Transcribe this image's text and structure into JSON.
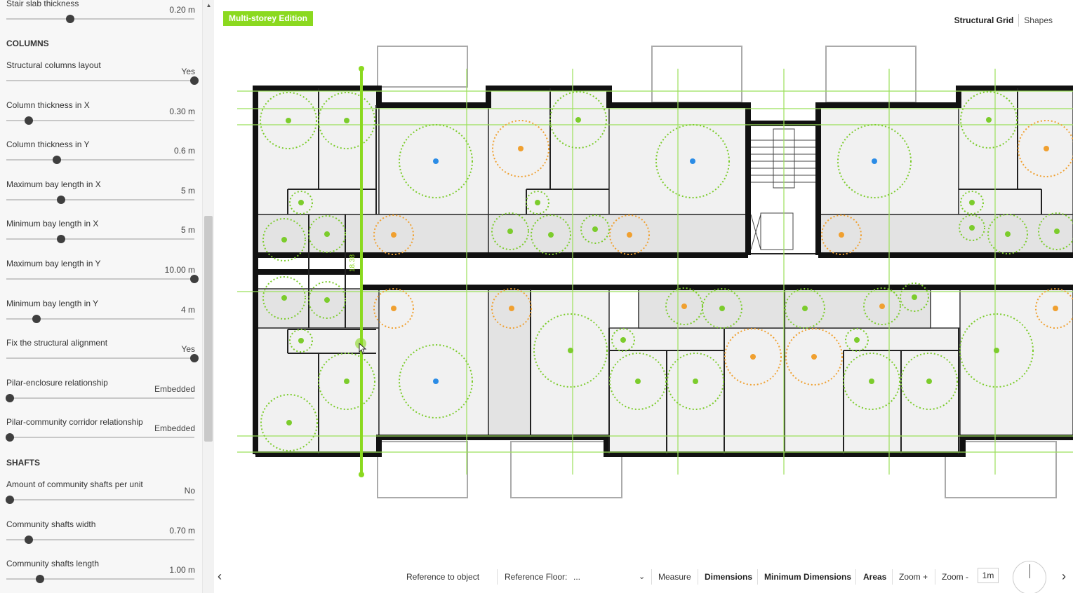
{
  "sidebar": {
    "partial_top": {
      "label": "Stair slab thickness",
      "value": "0.20 m",
      "level": 0.34
    },
    "columns_section": "COLUMNS",
    "columns": [
      {
        "label": "Structural columns layout",
        "value": "Yes",
        "level": 1.0
      },
      {
        "label": "Column thickness in X",
        "value": "0.30 m",
        "level": 0.12
      },
      {
        "label": "Column thickness in Y",
        "value": "0.6 m",
        "level": 0.27
      },
      {
        "label": "Maximum bay length in X",
        "value": "5 m",
        "level": 0.29
      },
      {
        "label": "Minimum bay length in X",
        "value": "5 m",
        "level": 0.29
      },
      {
        "label": "Maximum bay length in Y",
        "value": "10.00 m",
        "level": 1.0
      },
      {
        "label": "Minimum bay length in Y",
        "value": "4 m",
        "level": 0.16
      },
      {
        "label": "Fix the structural alignment",
        "value": "Yes",
        "level": 1.0
      },
      {
        "label": "Pilar-enclosure relationship",
        "value": "Embedded",
        "level": 0.02
      },
      {
        "label": "Pilar-community corridor relationship",
        "value": "Embedded",
        "level": 0.02
      }
    ],
    "shafts_section": "SHAFTS",
    "shafts": [
      {
        "label": "Amount of community shafts per unit",
        "value": "No",
        "level": 0.02
      },
      {
        "label": "Community shafts width",
        "value": "0.70 m",
        "level": 0.12
      },
      {
        "label": "Community shafts length",
        "value": "1.00 m",
        "level": 0.18
      }
    ]
  },
  "header": {
    "edition_badge": "Multi-storey Edition",
    "tabs": [
      {
        "label": "Structural Grid",
        "active": true
      },
      {
        "label": "Shapes",
        "active": false
      }
    ]
  },
  "plan": {
    "dimension_label": "18.38",
    "accent_color": "#8bd91f",
    "circle_colors": {
      "green": "#7ccc2c",
      "orange": "#f0a030",
      "blue": "#2b8ce6"
    }
  },
  "toolbar": {
    "reference_to_object": "Reference to object",
    "reference_floor": "Reference Floor:",
    "reference_floor_value": "...",
    "measure": "Measure",
    "dimensions": "Dimensions",
    "minimum_dimensions": "Minimum Dimensions",
    "areas": "Areas",
    "zoom_in": "Zoom +",
    "zoom_out": "Zoom -",
    "scale": "1m",
    "prev_icon": "chevron-left-icon",
    "next_icon": "chevron-right-icon"
  }
}
